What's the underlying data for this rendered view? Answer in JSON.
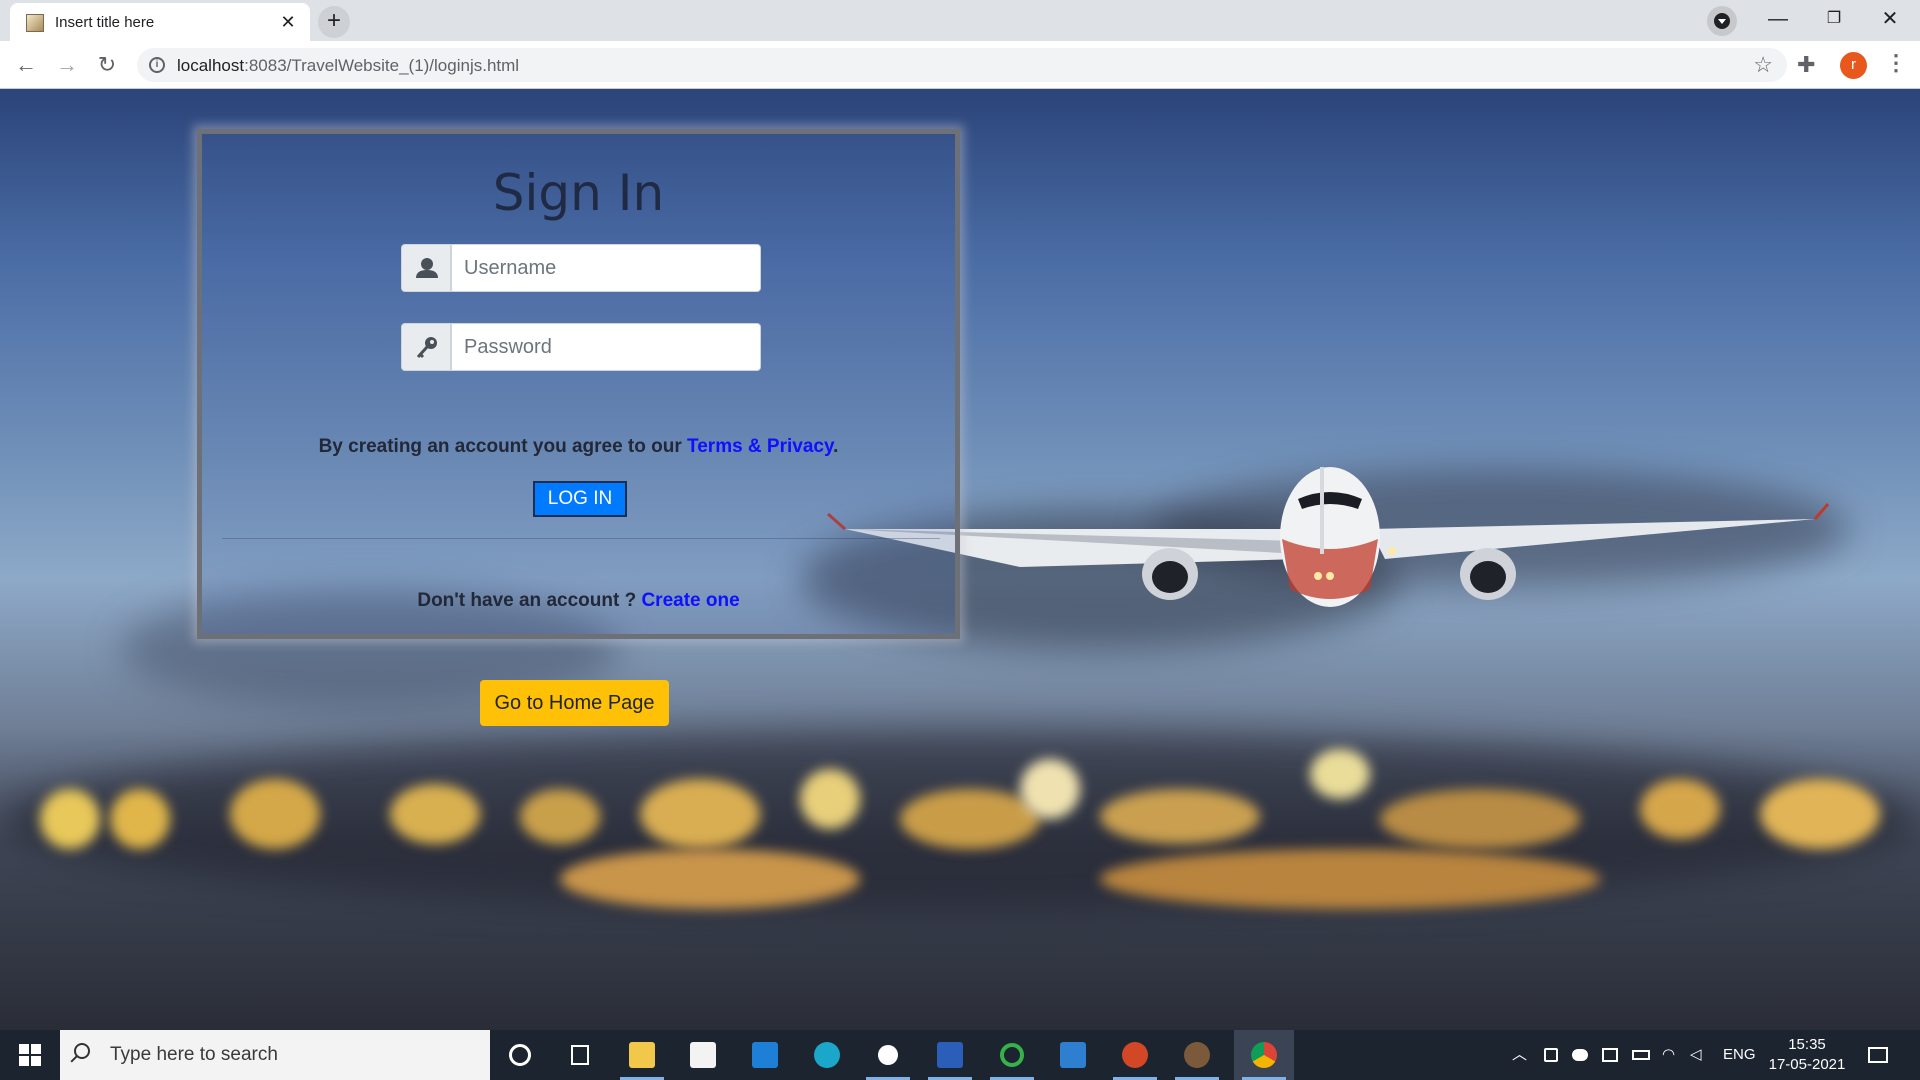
{
  "browser": {
    "tab_title": "Insert title here",
    "tab_close": "✕",
    "new_tab": "+",
    "url_host": "localhost",
    "url_rest": ":8083/TravelWebsite_(1)/loginjs.html",
    "avatar_letter": "r",
    "window_controls": [
      "—",
      "❐",
      "✕"
    ]
  },
  "login": {
    "title": "Sign In",
    "username_placeholder": "Username",
    "password_placeholder": "Password",
    "terms_prefix": "By creating an account you agree to our ",
    "terms_link": "Terms & Privacy",
    "terms_suffix": ".",
    "login_button": "LOG IN",
    "signup_prefix": "Don't have an account ? ",
    "signup_link": "Create one",
    "home_button": "Go to Home Page"
  },
  "taskbar": {
    "search_placeholder": "Type here to search",
    "language": "ENG",
    "time": "15:35",
    "date": "17-05-2021",
    "apps": [
      "cortana",
      "task-view",
      "file-explorer",
      "store",
      "mail",
      "edge",
      "settings",
      "word",
      "app-green",
      "photos",
      "powerpoint",
      "app-gear",
      "chrome"
    ]
  },
  "colors": {
    "login_button": "#007bff",
    "home_button": "#ffc107",
    "link": "#1010ff"
  }
}
